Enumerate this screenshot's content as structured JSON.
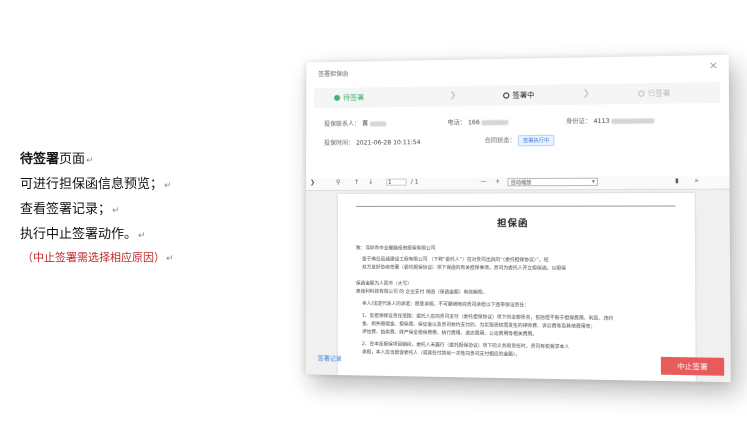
{
  "notes": {
    "heading_bold": "待签署",
    "heading_rest": "页面",
    "line1": "可进行担保函信息预览；",
    "line2": "查看签署记录；",
    "line3": "执行中止签署动作。",
    "red_note": "（中止签署需选择相应原因）",
    "para_mark": "↵"
  },
  "dialog": {
    "title": "签署担保函",
    "close": "×",
    "steps": [
      {
        "label": "待签署",
        "state": "done"
      },
      {
        "label": "签署中",
        "state": "active"
      },
      {
        "label": "已签署",
        "state": "pending"
      }
    ],
    "info": {
      "applicant_label": "投保联系人：",
      "applicant_value": "黄",
      "phone_label": "电话：",
      "phone_value": "166",
      "id_label": "身份证：",
      "id_value": "4113",
      "time_label": "投保时间：",
      "time_value": "2021-06-28 10:11:54",
      "status_label": "合同状态：",
      "status_value": "签署执行中"
    },
    "viewer": {
      "page_current": "1",
      "page_total": "/ 1",
      "zoom_value": "自动缩放",
      "minus": "—",
      "plus": "+",
      "more": "»"
    },
    "document": {
      "title": "担保函",
      "paras": [
        "致：深圳市中业耀融投资担保有限公司",
        "鉴于南岳后诚建设工程有限公司 （下称“委托人”）在对贵司出具的“（委托担保协议）”，经",
        "双方友好协商签署（委托担保协议）项下保函的有关担保事项，贵司为委托人开立担保函，以担保",
        "                                                                     保函金额为人民币（大写）",
        "奥佳利科技有限公司                         的 企业支付                    保函（保函金额）有效期限。",
        "本人/法定代表人的承诺：愿意承担，不可撤销地向贵司承担以下连带保证责任：",
        "1、反担保保证责任范围：委托人应向贵司支付（委托担保协议）项下的全部债务，包括但不限于担保费用、利息、违约",
        "金、损失赔偿金、担保费、保证金以及贵司依约支付的、为实现债权而发生的律师费、诉讼费等及其他费用等；",
        "评估费、拍卖费、财产保全担保费用、执行费用、送达费用、公证费用等相关费用。",
        "2、在本反担保项目期间，委托人未履行（委托担保协议）项下的义务和责任时，贵司有权要求本人",
        "承担，本人应当督促委托人（或其在付款前一次性向贵司支付相应的金额）。"
      ]
    },
    "footer": {
      "record_link": "签署记录",
      "stop_button": "中止签署"
    }
  }
}
